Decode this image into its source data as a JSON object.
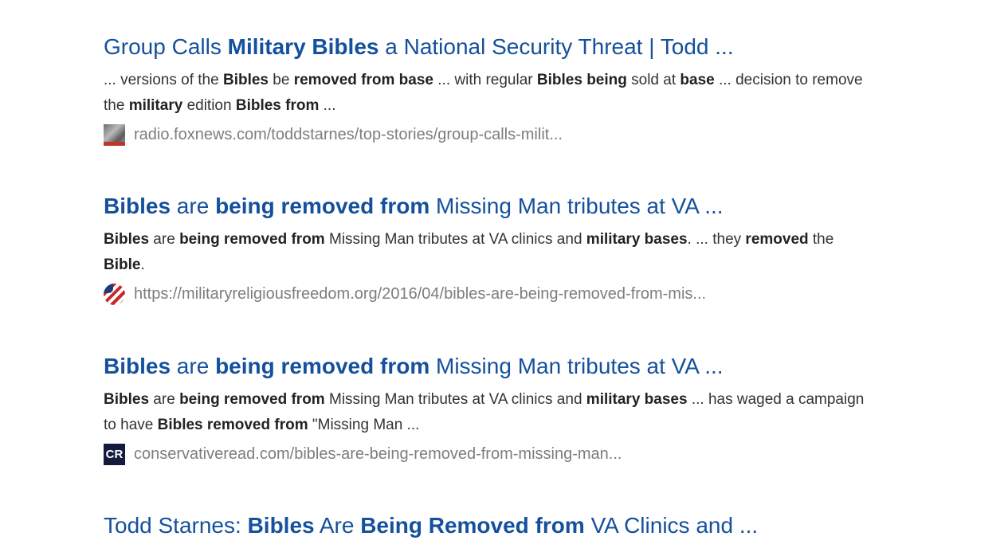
{
  "results": [
    {
      "title_parts": [
        {
          "t": "Group Calls ",
          "b": false
        },
        {
          "t": "Military Bibles",
          "b": true
        },
        {
          "t": " a National Security Threat | Todd ...",
          "b": false
        }
      ],
      "snippet_parts": [
        {
          "t": "... versions of the ",
          "b": false
        },
        {
          "t": "Bibles",
          "b": true
        },
        {
          "t": " be ",
          "b": false
        },
        {
          "t": "removed from base",
          "b": true
        },
        {
          "t": " ... with regular ",
          "b": false
        },
        {
          "t": "Bibles being",
          "b": true
        },
        {
          "t": " sold at ",
          "b": false
        },
        {
          "t": "base",
          "b": true
        },
        {
          "t": " ... decision to remove the ",
          "b": false
        },
        {
          "t": "military",
          "b": true
        },
        {
          "t": " edition ",
          "b": false
        },
        {
          "t": "Bibles from",
          "b": true
        },
        {
          "t": " ...",
          "b": false
        }
      ],
      "favicon": "foxnews-favicon",
      "url": "radio.foxnews.com/toddstarnes/top-stories/group-calls-milit..."
    },
    {
      "title_parts": [
        {
          "t": "Bibles",
          "b": true
        },
        {
          "t": " are ",
          "b": false
        },
        {
          "t": "being removed from",
          "b": true
        },
        {
          "t": " Missing Man tributes at VA ...",
          "b": false
        }
      ],
      "snippet_parts": [
        {
          "t": "Bibles",
          "b": true
        },
        {
          "t": " are ",
          "b": false
        },
        {
          "t": "being removed from",
          "b": true
        },
        {
          "t": " Missing Man tributes at VA clinics and ",
          "b": false
        },
        {
          "t": "military bases",
          "b": true
        },
        {
          "t": ". ... they ",
          "b": false
        },
        {
          "t": "removed",
          "b": true
        },
        {
          "t": " the ",
          "b": false
        },
        {
          "t": "Bible",
          "b": true
        },
        {
          "t": ".",
          "b": false
        }
      ],
      "favicon": "mrff-favicon",
      "url": "https://militaryreligiousfreedom.org/2016/04/bibles-are-being-removed-from-mis..."
    },
    {
      "title_parts": [
        {
          "t": "Bibles",
          "b": true
        },
        {
          "t": " are ",
          "b": false
        },
        {
          "t": "being removed from",
          "b": true
        },
        {
          "t": " Missing Man tributes at VA ...",
          "b": false
        }
      ],
      "snippet_parts": [
        {
          "t": "Bibles",
          "b": true
        },
        {
          "t": " are ",
          "b": false
        },
        {
          "t": "being removed from",
          "b": true
        },
        {
          "t": " Missing Man tributes at VA clinics and ",
          "b": false
        },
        {
          "t": "military bases",
          "b": true
        },
        {
          "t": " ... has waged a campaign to have ",
          "b": false
        },
        {
          "t": "Bibles removed from",
          "b": true
        },
        {
          "t": " \"Missing Man ...",
          "b": false
        }
      ],
      "favicon": "conservativeread-favicon",
      "favicon_text": "CR",
      "url": "conservativeread.com/bibles-are-being-removed-from-missing-man..."
    },
    {
      "title_parts": [
        {
          "t": "Todd Starnes: ",
          "b": false
        },
        {
          "t": "Bibles",
          "b": true
        },
        {
          "t": " Are ",
          "b": false
        },
        {
          "t": "Being Removed from",
          "b": true
        },
        {
          "t": " VA Clinics and ...",
          "b": false
        }
      ]
    }
  ],
  "colors": {
    "title": "#15509c",
    "snippet": "#333333",
    "url": "#7d7d7d",
    "background": "#ffffff"
  }
}
